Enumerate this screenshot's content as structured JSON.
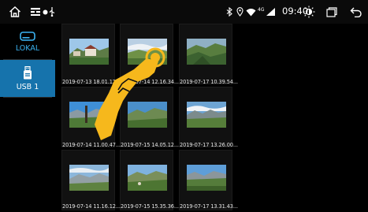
{
  "status_bar": {
    "clock": "09:40",
    "network": "4G",
    "icons": [
      "home-icon",
      "apps-icon",
      "usb-icon",
      "bluetooth-icon",
      "location-icon",
      "wifi-icon",
      "signal-icon",
      "brightness-icon",
      "recent-apps-icon",
      "back-icon"
    ]
  },
  "sidebar": {
    "items": [
      {
        "label": "LOKAL",
        "icon": "hard-drive-icon",
        "active": false
      },
      {
        "label": "USB 1",
        "icon": "usb-drive-icon",
        "active": true
      }
    ]
  },
  "gallery": {
    "photos": [
      {
        "caption": "2019-07-13 18.01.12..."
      },
      {
        "caption": "2019-07-14 12.16.34..."
      },
      {
        "caption": "2019-07-17 10.39.54..."
      },
      {
        "caption": "2019-07-14 11.00.47..."
      },
      {
        "caption": "2019-07-15 14.05.12..."
      },
      {
        "caption": "2019-07-17 13.26.00..."
      },
      {
        "caption": "2019-07-14 11.16.12..."
      },
      {
        "caption": "2019-07-15 15.35.36..."
      },
      {
        "caption": "2019-07-17 13.31.43..."
      }
    ]
  },
  "colors": {
    "accent": "#1673ac",
    "label_blue": "#3bb3f2",
    "hand": "#f6b81c"
  }
}
